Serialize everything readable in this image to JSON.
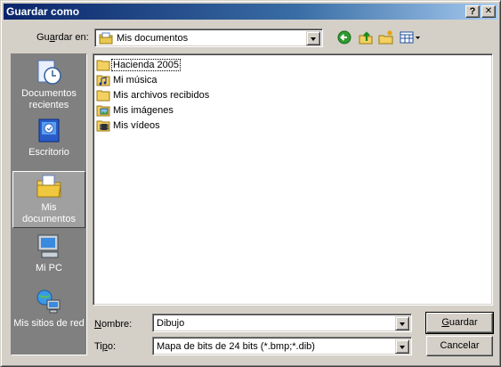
{
  "window": {
    "title": "Guardar como",
    "help_label": "?",
    "close_label": "✕"
  },
  "lookin": {
    "label_pre": "Gu",
    "label_ul": "a",
    "label_post": "rdar en:",
    "value": "Mis documentos"
  },
  "toolbar": {
    "icons": [
      "back-icon",
      "up-folder-icon",
      "new-folder-icon",
      "views-menu-icon"
    ]
  },
  "places": [
    {
      "label_line1": "Documentos",
      "label_line2": "recientes",
      "icon": "recent-documents-icon"
    },
    {
      "label_line1": "Escritorio",
      "label_line2": "",
      "icon": "desktop-icon"
    },
    {
      "label_line1": "Mis",
      "label_line2": "documentos",
      "icon": "my-documents-icon",
      "selected": true
    },
    {
      "label_line1": "Mi PC",
      "label_line2": "",
      "icon": "my-computer-icon"
    },
    {
      "label_line1": "Mis sitios de red",
      "label_line2": "",
      "icon": "network-places-icon"
    }
  ],
  "files": [
    {
      "label": "Hacienda 2005",
      "icon": "folder-icon"
    },
    {
      "label": "Mi música",
      "icon": "music-folder-icon"
    },
    {
      "label": "Mis archivos recibidos",
      "icon": "folder-icon"
    },
    {
      "label": "Mis imágenes",
      "icon": "pictures-folder-icon"
    },
    {
      "label": "Mis vídeos",
      "icon": "videos-folder-icon"
    }
  ],
  "filename": {
    "label_ul": "N",
    "label_post": "ombre:",
    "value": "Dibujo"
  },
  "filetype": {
    "label_pre": "Ti",
    "label_ul": "p",
    "label_post": "o:",
    "value": "Mapa de bits de 24 bits (*.bmp;*.dib)"
  },
  "buttons": {
    "save_pre": "",
    "save_ul": "G",
    "save_post": "uardar",
    "cancel": "Cancelar"
  }
}
